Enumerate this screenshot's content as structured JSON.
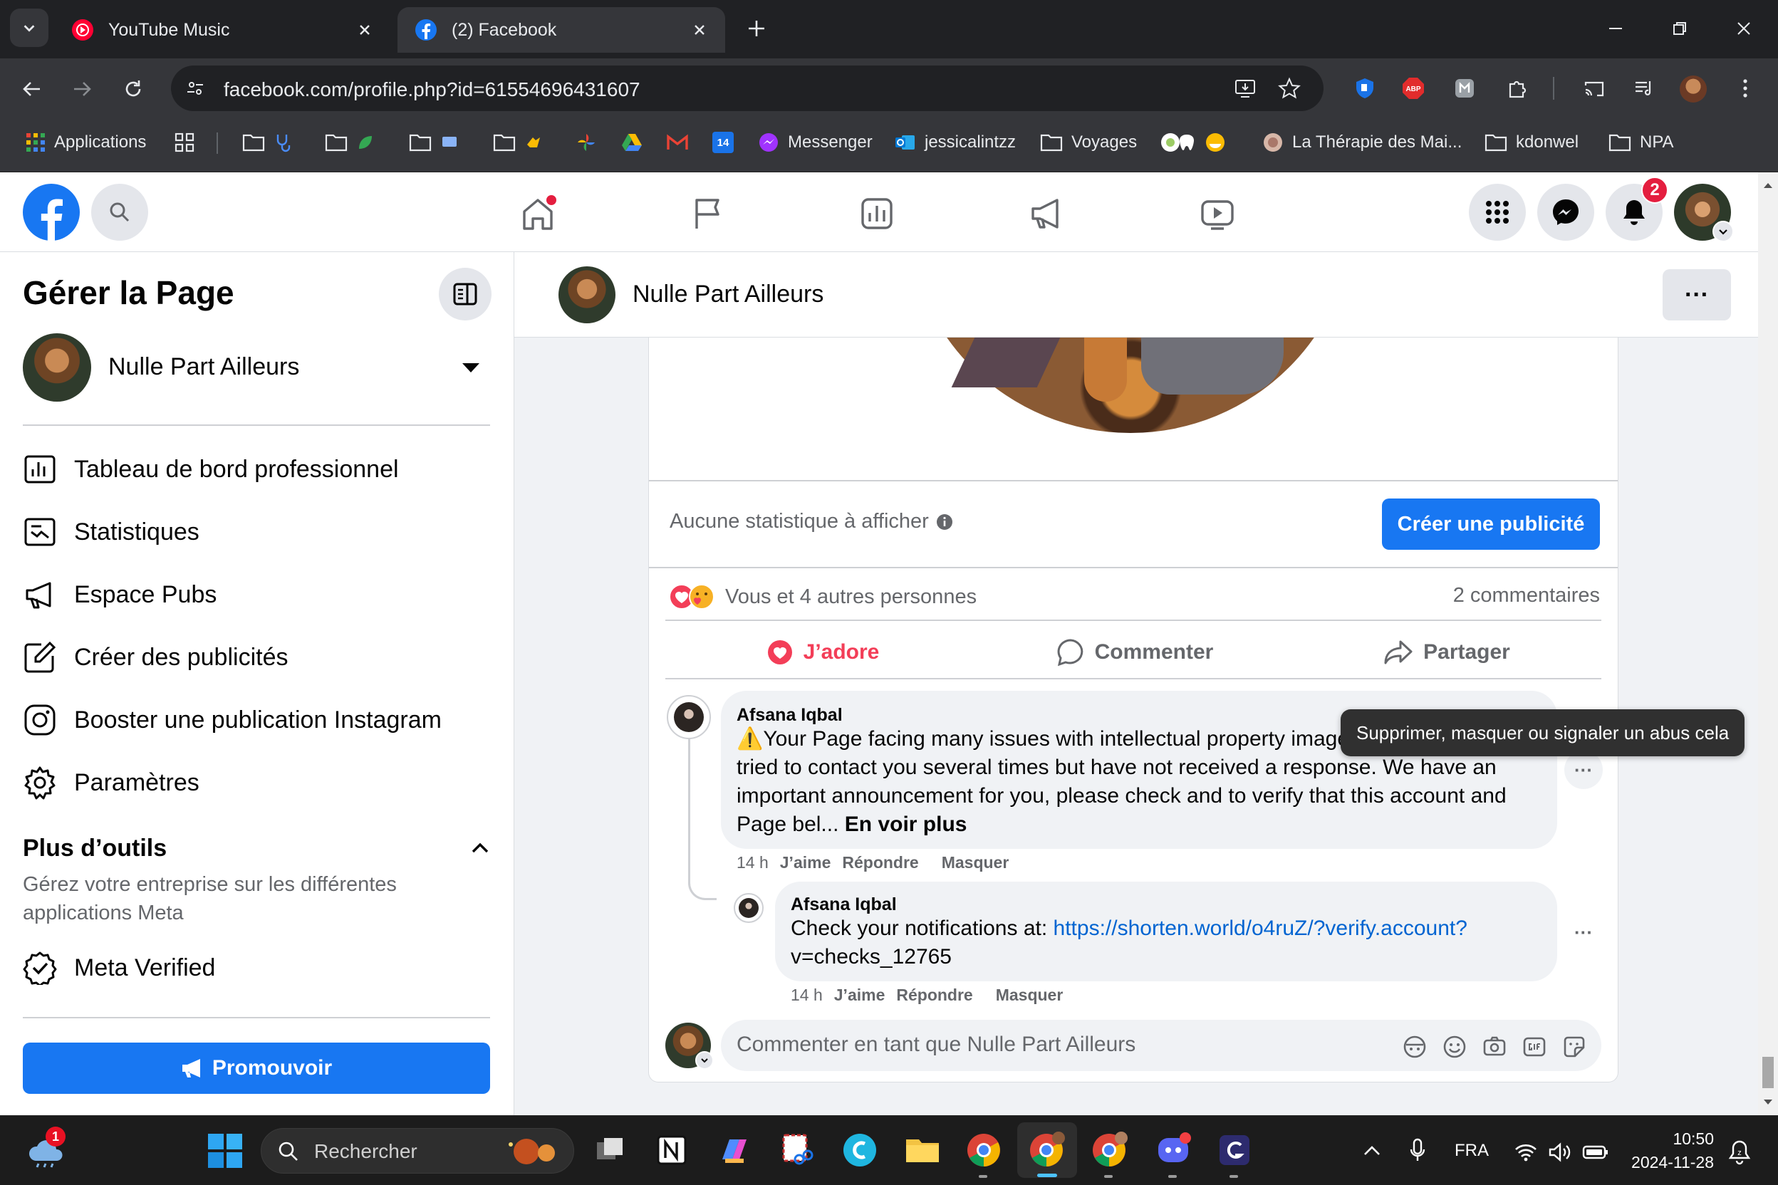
{
  "browser": {
    "tabs": [
      {
        "title": "YouTube Music",
        "active": false
      },
      {
        "title": "(2) Facebook",
        "active": true
      }
    ],
    "url": "facebook.com/profile.php?id=61554696431607",
    "bookmarks": [
      {
        "label": "Applications",
        "icon": "apps-grid-icon"
      },
      {
        "label": "Messenger",
        "icon": "messenger-icon"
      },
      {
        "label": "jessicalintzz",
        "icon": "outlook-icon"
      },
      {
        "label": "Voyages",
        "icon": "folder-icon"
      },
      {
        "label": "La Thérapie des Mai...",
        "icon": "site-icon"
      },
      {
        "label": "kdonwel",
        "icon": "folder-icon"
      },
      {
        "label": "NPA",
        "icon": "folder-icon"
      }
    ],
    "calendar_badge": "14",
    "abp_label": "ABP"
  },
  "facebook": {
    "notif_count": "2",
    "sidebar": {
      "title": "Gérer la Page",
      "page_name": "Nulle Part Ailleurs",
      "items": [
        {
          "label": "Tableau de bord professionnel",
          "icon": "dashboard-icon"
        },
        {
          "label": "Statistiques",
          "icon": "insights-icon"
        },
        {
          "label": "Espace Pubs",
          "icon": "megaphone-icon"
        },
        {
          "label": "Créer des publicités",
          "icon": "edit-icon"
        },
        {
          "label": "Booster une publication Instagram",
          "icon": "instagram-icon"
        },
        {
          "label": "Paramètres",
          "icon": "gear-icon"
        }
      ],
      "more_tools_title": "Plus d’outils",
      "more_tools_desc": "Gérez votre entreprise sur les différentes applications Meta",
      "meta_verified": "Meta Verified",
      "promote_label": "Promouvoir"
    },
    "page_header": {
      "name": "Nulle Part Ailleurs",
      "more": "···"
    },
    "post": {
      "no_stats": "Aucune statistique à afficher",
      "create_ad": "Créer une publicité",
      "reactions_text": "Vous et 4 autres personnes",
      "comments_count": "2 commentaires",
      "actions": {
        "like": "J’adore",
        "comment": "Commenter",
        "share": "Partager"
      }
    },
    "comments": [
      {
        "author": "Afsana Iqbal",
        "warning": "⚠️",
        "line1": "Your Page facing many issues with intellectual property image copyright. We have",
        "line2": "tried to contact you several times but have not received a response. We have an",
        "line3": "important announcement for you, please check and to verify that this account and",
        "line4": "Page bel...",
        "see_more": "En voir plus",
        "time": "14 h",
        "like": "J’aime",
        "reply": "Répondre",
        "hide": "Masquer"
      },
      {
        "author": "Afsana Iqbal",
        "text": "Check your notifications at:",
        "link1": "https://shorten.world/o4ruZ/?verify.account?",
        "link2": "v=checks_12765",
        "time": "14 h",
        "like": "J’aime",
        "reply": "Répondre",
        "hide": "Masquer"
      }
    ],
    "tooltip": "Supprimer, masquer ou signaler un abus cela",
    "comment_input_placeholder": "Commenter en tant que Nulle Part Ailleurs"
  },
  "taskbar": {
    "weather_badge": "1",
    "search_label": "Rechercher",
    "language": "FRA",
    "time": "10:50",
    "date": "2024-11-28"
  },
  "colors": {
    "fb_blue": "#1877f2",
    "love_red": "#f33e58",
    "link_blue": "#0064d1"
  }
}
